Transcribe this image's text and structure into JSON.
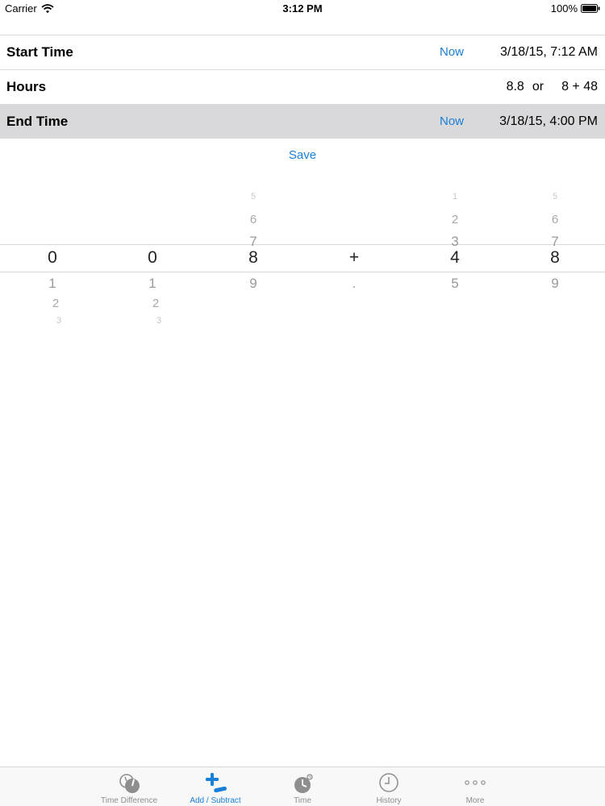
{
  "status_bar": {
    "carrier": "Carrier",
    "time": "3:12 PM",
    "battery": "100%"
  },
  "rows": {
    "start": {
      "label": "Start Time",
      "now": "Now",
      "value": "3/18/15, 7:12 AM"
    },
    "hours": {
      "label": "Hours",
      "decimal": "8.8",
      "or": "or",
      "hm": "8 + 48"
    },
    "end": {
      "label": "End Time",
      "now": "Now",
      "value": "3/18/15, 4:00 PM"
    }
  },
  "save_label": "Save",
  "picker": {
    "columns": [
      {
        "selected": "0",
        "above": [
          "",
          "",
          ""
        ],
        "below": [
          "1",
          "2",
          "3"
        ]
      },
      {
        "selected": "0",
        "above": [
          "",
          "",
          ""
        ],
        "below": [
          "1",
          "2",
          "3"
        ]
      },
      {
        "selected": "8",
        "above": [
          "5",
          "6",
          "7"
        ],
        "below": [
          "9",
          "",
          ""
        ]
      },
      {
        "selected": "+",
        "above": [
          "",
          "",
          ""
        ],
        "below": [
          ".",
          "",
          ""
        ]
      },
      {
        "selected": "4",
        "above": [
          "1",
          "2",
          "3"
        ],
        "below": [
          "5",
          "",
          ""
        ]
      },
      {
        "selected": "8",
        "above": [
          "5",
          "6",
          "7"
        ],
        "below": [
          "9",
          "",
          ""
        ]
      }
    ]
  },
  "tabs": [
    {
      "label": "Time Difference",
      "icon": "time-difference-icon",
      "active": false
    },
    {
      "label": "Add / Subtract",
      "icon": "add-subtract-icon",
      "active": true
    },
    {
      "label": "Time",
      "icon": "time-icon",
      "active": false
    },
    {
      "label": "History",
      "icon": "history-icon",
      "active": false
    },
    {
      "label": "More",
      "icon": "more-icon",
      "active": false
    }
  ],
  "colors": {
    "accent": "#1a7fd6",
    "selected_row": "#d9d9db",
    "tab_inactive": "#8e8e8e"
  }
}
